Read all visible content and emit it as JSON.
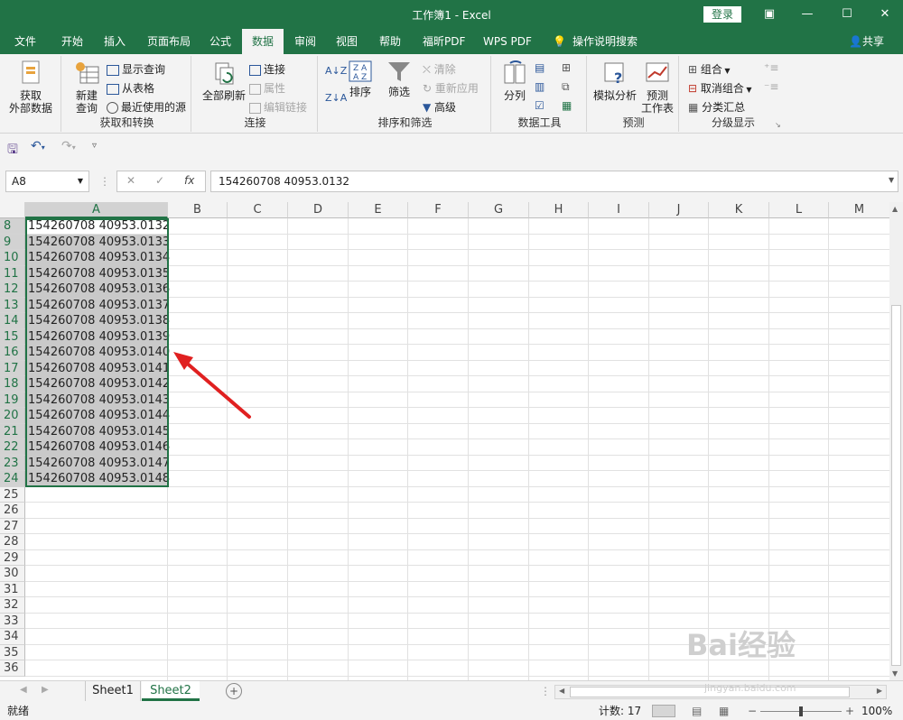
{
  "window": {
    "title": "工作簿1 - Excel",
    "login_label": "登录"
  },
  "tabs": [
    {
      "label": "文件"
    },
    {
      "label": "开始"
    },
    {
      "label": "插入"
    },
    {
      "label": "页面布局"
    },
    {
      "label": "公式"
    },
    {
      "label": "数据"
    },
    {
      "label": "审阅"
    },
    {
      "label": "视图"
    },
    {
      "label": "帮助"
    },
    {
      "label": "福昕PDF"
    },
    {
      "label": "WPS PDF"
    },
    {
      "label": "操作说明搜索"
    }
  ],
  "share_label": "共享",
  "ribbon": {
    "get_external": "获取\n外部数据",
    "new_query": "新建\n查询",
    "show_queries": "显示查询",
    "from_table": "从表格",
    "recent_sources": "最近使用的源",
    "group_get_transform": "获取和转换",
    "refresh_all": "全部刷新",
    "connections": "连接",
    "properties": "属性",
    "edit_links": "编辑链接",
    "group_connections": "连接",
    "sort": "排序",
    "filter": "筛选",
    "clear": "清除",
    "reapply": "重新应用",
    "advanced": "高级",
    "group_sort_filter": "排序和筛选",
    "text_to_columns": "分列",
    "group_data_tools": "数据工具",
    "what_if": "模拟分析",
    "forecast_sheet": "预测\n工作表",
    "group_forecast": "预测",
    "group": "组合",
    "ungroup": "取消组合",
    "subtotal": "分类汇总",
    "group_outline": "分级显示"
  },
  "formula_bar": {
    "name_box": "A8",
    "formula": "154260708 40953.0132"
  },
  "columns": [
    "A",
    "B",
    "C",
    "D",
    "E",
    "F",
    "G",
    "H",
    "I",
    "J",
    "K",
    "L",
    "M"
  ],
  "rows": [
    {
      "num": "8",
      "a": "154260708 40953.0132"
    },
    {
      "num": "9",
      "a": "154260708 40953.0133"
    },
    {
      "num": "10",
      "a": "154260708 40953.0134"
    },
    {
      "num": "11",
      "a": "154260708 40953.0135"
    },
    {
      "num": "12",
      "a": "154260708 40953.0136"
    },
    {
      "num": "13",
      "a": "154260708 40953.0137"
    },
    {
      "num": "14",
      "a": "154260708 40953.0138"
    },
    {
      "num": "15",
      "a": "154260708 40953.0139"
    },
    {
      "num": "16",
      "a": "154260708 40953.0140"
    },
    {
      "num": "17",
      "a": "154260708 40953.0141"
    },
    {
      "num": "18",
      "a": "154260708 40953.0142"
    },
    {
      "num": "19",
      "a": "154260708 40953.0143"
    },
    {
      "num": "20",
      "a": "154260708 40953.0144"
    },
    {
      "num": "21",
      "a": "154260708 40953.0145"
    },
    {
      "num": "22",
      "a": "154260708 40953.0146"
    },
    {
      "num": "23",
      "a": "154260708 40953.0147"
    },
    {
      "num": "24",
      "a": "154260708 40953.0148"
    },
    {
      "num": "25",
      "a": ""
    },
    {
      "num": "26",
      "a": ""
    },
    {
      "num": "27",
      "a": ""
    },
    {
      "num": "28",
      "a": ""
    },
    {
      "num": "29",
      "a": ""
    },
    {
      "num": "30",
      "a": ""
    },
    {
      "num": "31",
      "a": ""
    },
    {
      "num": "32",
      "a": ""
    },
    {
      "num": "33",
      "a": ""
    },
    {
      "num": "34",
      "a": ""
    },
    {
      "num": "35",
      "a": ""
    },
    {
      "num": "36",
      "a": ""
    }
  ],
  "sheets": [
    {
      "label": "Sheet1"
    },
    {
      "label": "Sheet2"
    }
  ],
  "status": {
    "ready": "就绪",
    "count": "计数: 17",
    "zoom": "100%"
  },
  "watermark": {
    "brand": "Bai经验",
    "url": "jingyan.baidu.com"
  },
  "colors": {
    "excel_green": "#217346",
    "arrow_red": "#e02020"
  }
}
